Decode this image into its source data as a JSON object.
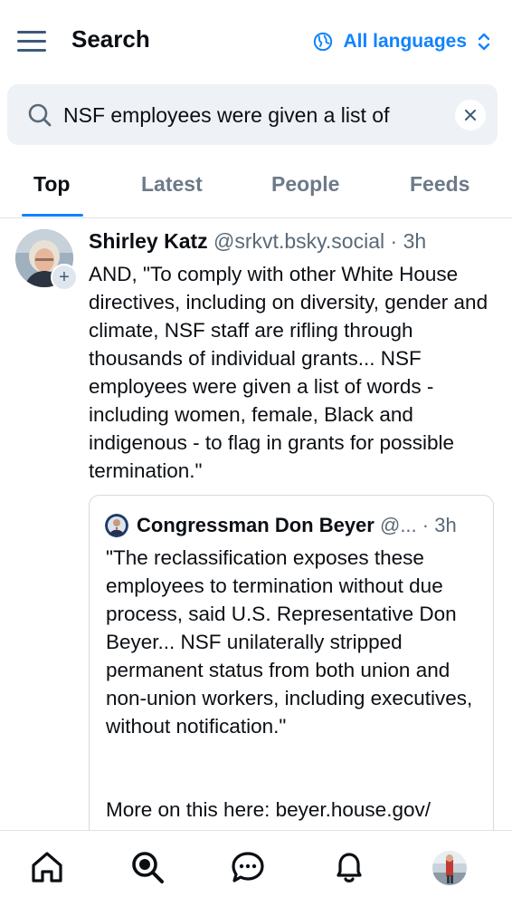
{
  "header": {
    "title": "Search",
    "language_label": "All languages",
    "accent_color": "#1083fe"
  },
  "search": {
    "value": "NSF employees were given a list of",
    "placeholder": ""
  },
  "tabs": [
    {
      "label": "Top",
      "active": true
    },
    {
      "label": "Latest",
      "active": false
    },
    {
      "label": "People",
      "active": false
    },
    {
      "label": "Feeds",
      "active": false
    }
  ],
  "post": {
    "author_name": "Shirley Katz",
    "author_handle": "@srkvt.bsky.social",
    "separator": "·",
    "time": "3h",
    "text": "AND, \"To comply with other White House directives, including on diversity, gender and climate, NSF staff are rifling through thousands of individual grants... NSF employees were given a list of words - including women, female, Black and indigenous - to flag in grants for possible termination.\"",
    "quote": {
      "author_name": "Congressman Don Beyer",
      "author_handle": "@...",
      "separator": "·",
      "time": "3h",
      "text": "\"The reclassification exposes these employees to termination without due process, said U.S. Representative Don Beyer... NSF unilaterally stripped permanent status from both union and non-union workers, including executives, without notification.\"",
      "more_text": "More on this here: beyer.house.gov/"
    }
  },
  "bottom_nav": {
    "items": [
      {
        "icon": "home-icon"
      },
      {
        "icon": "search-icon",
        "active": true
      },
      {
        "icon": "chat-icon"
      },
      {
        "icon": "bell-icon"
      },
      {
        "icon": "profile-avatar"
      }
    ]
  }
}
